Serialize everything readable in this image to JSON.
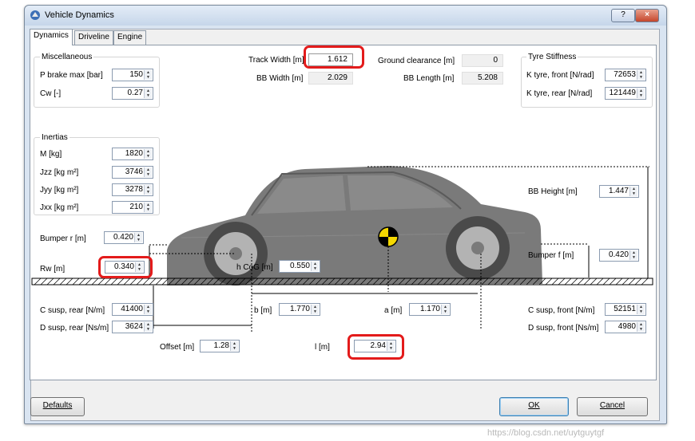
{
  "window": {
    "title": "Vehicle Dynamics",
    "help_btn": "?",
    "close_btn": "×"
  },
  "tabs": [
    {
      "label": "Dynamics"
    },
    {
      "label": "Driveline"
    },
    {
      "label": "Engine"
    }
  ],
  "misc": {
    "title": "Miscellaneous",
    "p_brake_label": "P brake max [bar]",
    "p_brake_value": "150",
    "cw_label": "Cw [-]",
    "cw_value": "0.27"
  },
  "inertias": {
    "title": "Inertias",
    "m_label": "M [kg]",
    "m_value": "1820",
    "jzz_label": "Jzz [kg m²]",
    "jzz_value": "3746",
    "jyy_label": "Jyy [kg m²]",
    "jyy_value": "3278",
    "jxx_label": "Jxx [kg m²]",
    "jxx_value": "210"
  },
  "top": {
    "track_label": "Track Width [m]",
    "track_value": "1.612",
    "bbw_label": "BB Width [m]",
    "bbw_value": "2.029",
    "gc_label": "Ground clearance [m]",
    "gc_value": "0",
    "bbl_label": "BB Length [m]",
    "bbl_value": "5.208"
  },
  "tyre": {
    "title": "Tyre Stiffness",
    "front_label": "K tyre, front  [N/rad]",
    "front_value": "72653",
    "rear_label": "K tyre, rear  [N/rad]",
    "rear_value": "121449"
  },
  "geometry": {
    "bb_height_label": "BB Height [m]",
    "bb_height_value": "1.447",
    "bumper_r_label": "Bumper r [m]",
    "bumper_r_value": "0.420",
    "bumper_f_label": "Bumper f [m]",
    "bumper_f_value": "0.420",
    "rw_label": "Rw [m]",
    "rw_value": "0.340",
    "hcog_label": "h CoG [m]",
    "hcog_value": "0.550",
    "b_label": "b [m]",
    "b_value": "1.770",
    "a_label": "a [m]",
    "a_value": "1.170",
    "offset_label": "Offset [m]",
    "offset_value": "1.28",
    "l_label": "l [m]",
    "l_value": "2.94"
  },
  "suspension": {
    "c_rear_label": "C susp, rear  [N/m]",
    "c_rear_value": "41400",
    "d_rear_label": "D susp, rear [Ns/m]",
    "d_rear_value": "3624",
    "c_front_label": "C susp, front [N/m]",
    "c_front_value": "52151",
    "d_front_label": "D susp, front [Ns/m]",
    "d_front_value": "4980"
  },
  "buttons": {
    "defaults": "Defaults",
    "ok": "OK",
    "cancel": "Cancel"
  },
  "watermark": "https://blog.csdn.net/uytguytgf",
  "colors": {
    "highlight": "#e31b1b",
    "car_body": "#6f6f6f",
    "cog_marker": "#f5d800"
  }
}
